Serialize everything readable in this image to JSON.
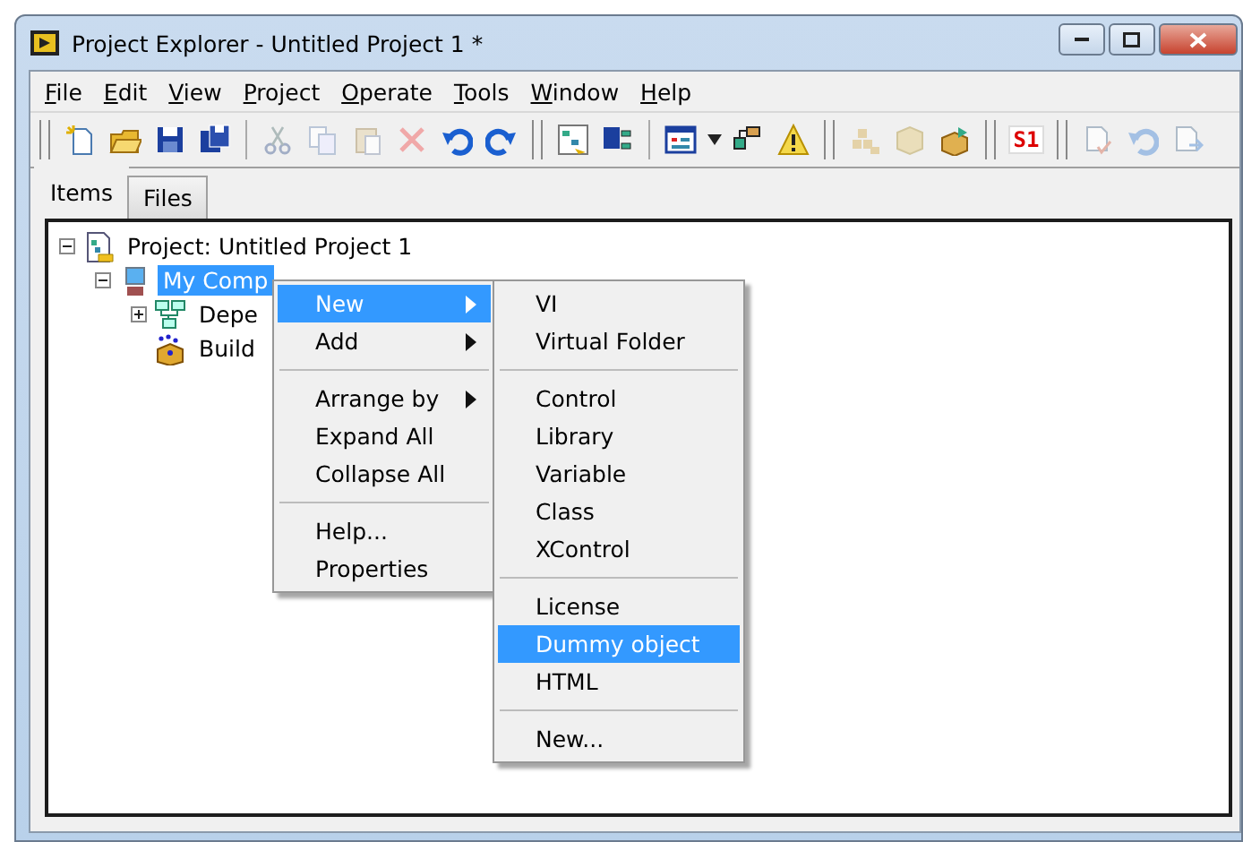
{
  "window": {
    "title": "Project Explorer - Untitled Project 1 *"
  },
  "menu_bar": [
    {
      "label": "File"
    },
    {
      "label": "Edit"
    },
    {
      "label": "View"
    },
    {
      "label": "Project"
    },
    {
      "label": "Operate"
    },
    {
      "label": "Tools"
    },
    {
      "label": "Window"
    },
    {
      "label": "Help"
    }
  ],
  "toolbar": [
    {
      "kind": "grip"
    },
    {
      "kind": "new",
      "disabled": false
    },
    {
      "kind": "open",
      "disabled": false
    },
    {
      "kind": "save",
      "disabled": false
    },
    {
      "kind": "save-all",
      "disabled": false
    },
    {
      "kind": "sep"
    },
    {
      "kind": "cut",
      "disabled": true
    },
    {
      "kind": "copy",
      "disabled": true
    },
    {
      "kind": "paste",
      "disabled": true
    },
    {
      "kind": "delete",
      "disabled": true
    },
    {
      "kind": "undo",
      "disabled": false
    },
    {
      "kind": "redo",
      "disabled": false
    },
    {
      "kind": "grip"
    },
    {
      "kind": "build",
      "disabled": false
    },
    {
      "kind": "save-hier",
      "disabled": false
    },
    {
      "kind": "sep"
    },
    {
      "kind": "view",
      "disabled": false
    },
    {
      "kind": "caret",
      "disabled": false
    },
    {
      "kind": "resolve",
      "disabled": false
    },
    {
      "kind": "warning",
      "disabled": false
    },
    {
      "kind": "grip"
    },
    {
      "kind": "blocks",
      "disabled": true
    },
    {
      "kind": "box",
      "disabled": true
    },
    {
      "kind": "package",
      "disabled": false
    },
    {
      "kind": "grip"
    },
    {
      "kind": "text",
      "label": "S1",
      "disabled": false
    },
    {
      "kind": "grip"
    },
    {
      "kind": "doc-check",
      "disabled": true
    },
    {
      "kind": "undo-check",
      "disabled": true
    },
    {
      "kind": "doc-arrow",
      "disabled": true
    }
  ],
  "tabs": [
    {
      "label": "Items",
      "selected": true
    },
    {
      "label": "Files",
      "selected": false
    }
  ],
  "tree": [
    {
      "label": "Project: Untitled Project 1",
      "kind": "project",
      "expanded": true,
      "selected": false,
      "children": [
        {
          "label": "My Comp",
          "kind": "computer",
          "expanded": true,
          "selected": true,
          "children": [
            {
              "label": "Depe",
              "kind": "dependencies",
              "expanded": false,
              "selected": false
            },
            {
              "label": "Build",
              "kind": "build",
              "selected": false
            }
          ]
        }
      ]
    }
  ],
  "context_menu": [
    {
      "kind": "item",
      "label": "New",
      "submenu": true,
      "selected": true
    },
    {
      "kind": "item",
      "label": "Add",
      "submenu": true,
      "selected": false
    },
    {
      "kind": "separator"
    },
    {
      "kind": "item",
      "label": "Arrange by",
      "submenu": true,
      "selected": false
    },
    {
      "kind": "item",
      "label": "Expand All",
      "submenu": false,
      "selected": false
    },
    {
      "kind": "item",
      "label": "Collapse All",
      "submenu": false,
      "selected": false
    },
    {
      "kind": "separator"
    },
    {
      "kind": "item",
      "label": "Help...",
      "submenu": false,
      "selected": false
    },
    {
      "kind": "item",
      "label": "Properties",
      "submenu": false,
      "selected": false
    }
  ],
  "submenu": [
    {
      "kind": "item",
      "label": "VI",
      "selected": false
    },
    {
      "kind": "item",
      "label": "Virtual Folder",
      "selected": false
    },
    {
      "kind": "separator"
    },
    {
      "kind": "item",
      "label": "Control",
      "selected": false
    },
    {
      "kind": "item",
      "label": "Library",
      "selected": false
    },
    {
      "kind": "item",
      "label": "Variable",
      "selected": false
    },
    {
      "kind": "item",
      "label": "Class",
      "selected": false
    },
    {
      "kind": "item",
      "label": "XControl",
      "selected": false
    },
    {
      "kind": "separator"
    },
    {
      "kind": "item",
      "label": "License",
      "selected": false
    },
    {
      "kind": "item",
      "label": "Dummy object",
      "selected": true
    },
    {
      "kind": "item",
      "label": "HTML",
      "selected": false
    },
    {
      "kind": "separator"
    },
    {
      "kind": "item",
      "label": "New...",
      "selected": false
    }
  ]
}
